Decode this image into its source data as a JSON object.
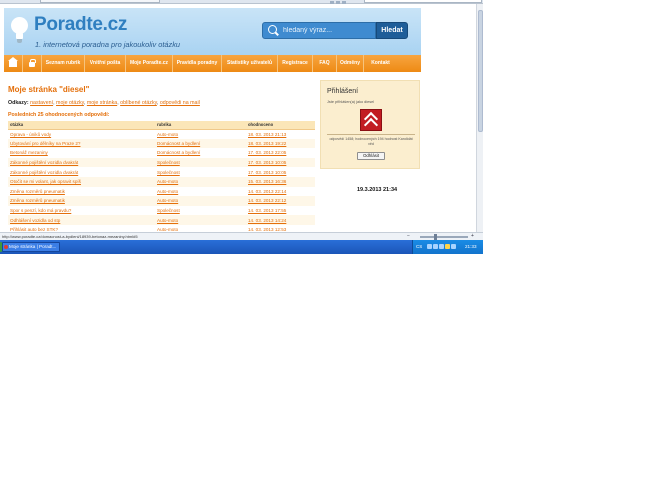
{
  "site": {
    "logo_title": "Poradte.cz",
    "tagline": "1. internetová poradna pro jakoukoliv otázku",
    "search_placeholder": "hledaný výraz...",
    "search_button": "Hledat"
  },
  "nav": {
    "items": [
      {
        "label": "Seznam rubrik"
      },
      {
        "label": "Vnitřní pošta"
      },
      {
        "label": "Moje Poradte.cz"
      },
      {
        "label": "Pravidla poradny"
      },
      {
        "label": "Statistiky uživatelů"
      },
      {
        "label": "Registrace"
      },
      {
        "label": "FAQ"
      },
      {
        "label": "Odměny"
      },
      {
        "label": "Kontakt"
      }
    ]
  },
  "main": {
    "page_title": "Moje stránka \"diesel\"",
    "links_label": "Odkazy:",
    "links": [
      "nastavení",
      "moje otázky",
      "moje stránka",
      "oblíbené otázky",
      "odpovědi na mail"
    ],
    "recent_title": "Posledních 25 ohodnocených odpovědí:",
    "table": {
      "headers": [
        "otázka",
        "rubrika",
        "ohodnoceno"
      ],
      "rows": [
        {
          "question": "Oprava - úniků vody",
          "category": "Auto-moto",
          "date": "18. 03. 2013 21:13"
        },
        {
          "question": "Ubytování pro dělníky na Praze 2?",
          "category": "Domácnost a bydlení",
          "date": "18. 03. 2013 19:22"
        },
        {
          "question": "Betonáž mezaniny",
          "category": "Domácnost a bydlení",
          "date": "17. 03. 2013 22:05"
        },
        {
          "question": "Zákonné pojištění vozidla dvakrát",
          "category": "Společnost",
          "date": "17. 03. 2013 10:05"
        },
        {
          "question": "Zákonné pojištění vozidla dvakrát",
          "category": "Společnost",
          "date": "17. 03. 2013 10:05"
        },
        {
          "question": "Otočit se mi volant, jak opravit spíš",
          "category": "Auto-moto",
          "date": "15. 03. 2013 16:36"
        },
        {
          "question": "Změna rozměrů pneumatik",
          "category": "Auto-moto",
          "date": "14. 03. 2013 22:14"
        },
        {
          "question": "Změna rozměrů pneumatik",
          "category": "Auto-moto",
          "date": "14. 03. 2013 22:12"
        },
        {
          "question": "Spor s penzí, kdo má pravdu?",
          "category": "Společnost",
          "date": "14. 03. 2013 17:55"
        },
        {
          "question": "Odhlášení vozidla od stp",
          "category": "Auto-moto",
          "date": "14. 03. 2013 14:24"
        },
        {
          "question": "Přihlásit auto bez STK?",
          "category": "Auto-moto",
          "date": "14. 03. 2013 12:53"
        }
      ]
    }
  },
  "login_box": {
    "title": "Přihlášení",
    "user_text": "Jste přihlášen(a) jako diesel",
    "stats_text": "odpovědí 1458; hodnocených 194 hodnost Kandidát věd",
    "logout_button": "Odhlásit"
  },
  "datetime": "19.3.2013 21:34",
  "status_bar": {
    "url": "http://www.poradte.cz/domacnost-a-bydleni/18939-betonaz-mezaniny.html#5"
  },
  "taskbar": {
    "task_label": "Moje stránka | Poradt...",
    "tray_lang": "CS",
    "tray_clock": "21:33"
  },
  "colors": {
    "accent_orange": "#ee8a14",
    "header_blue": "#a9d3f2",
    "link_orange": "#e46f0a"
  }
}
